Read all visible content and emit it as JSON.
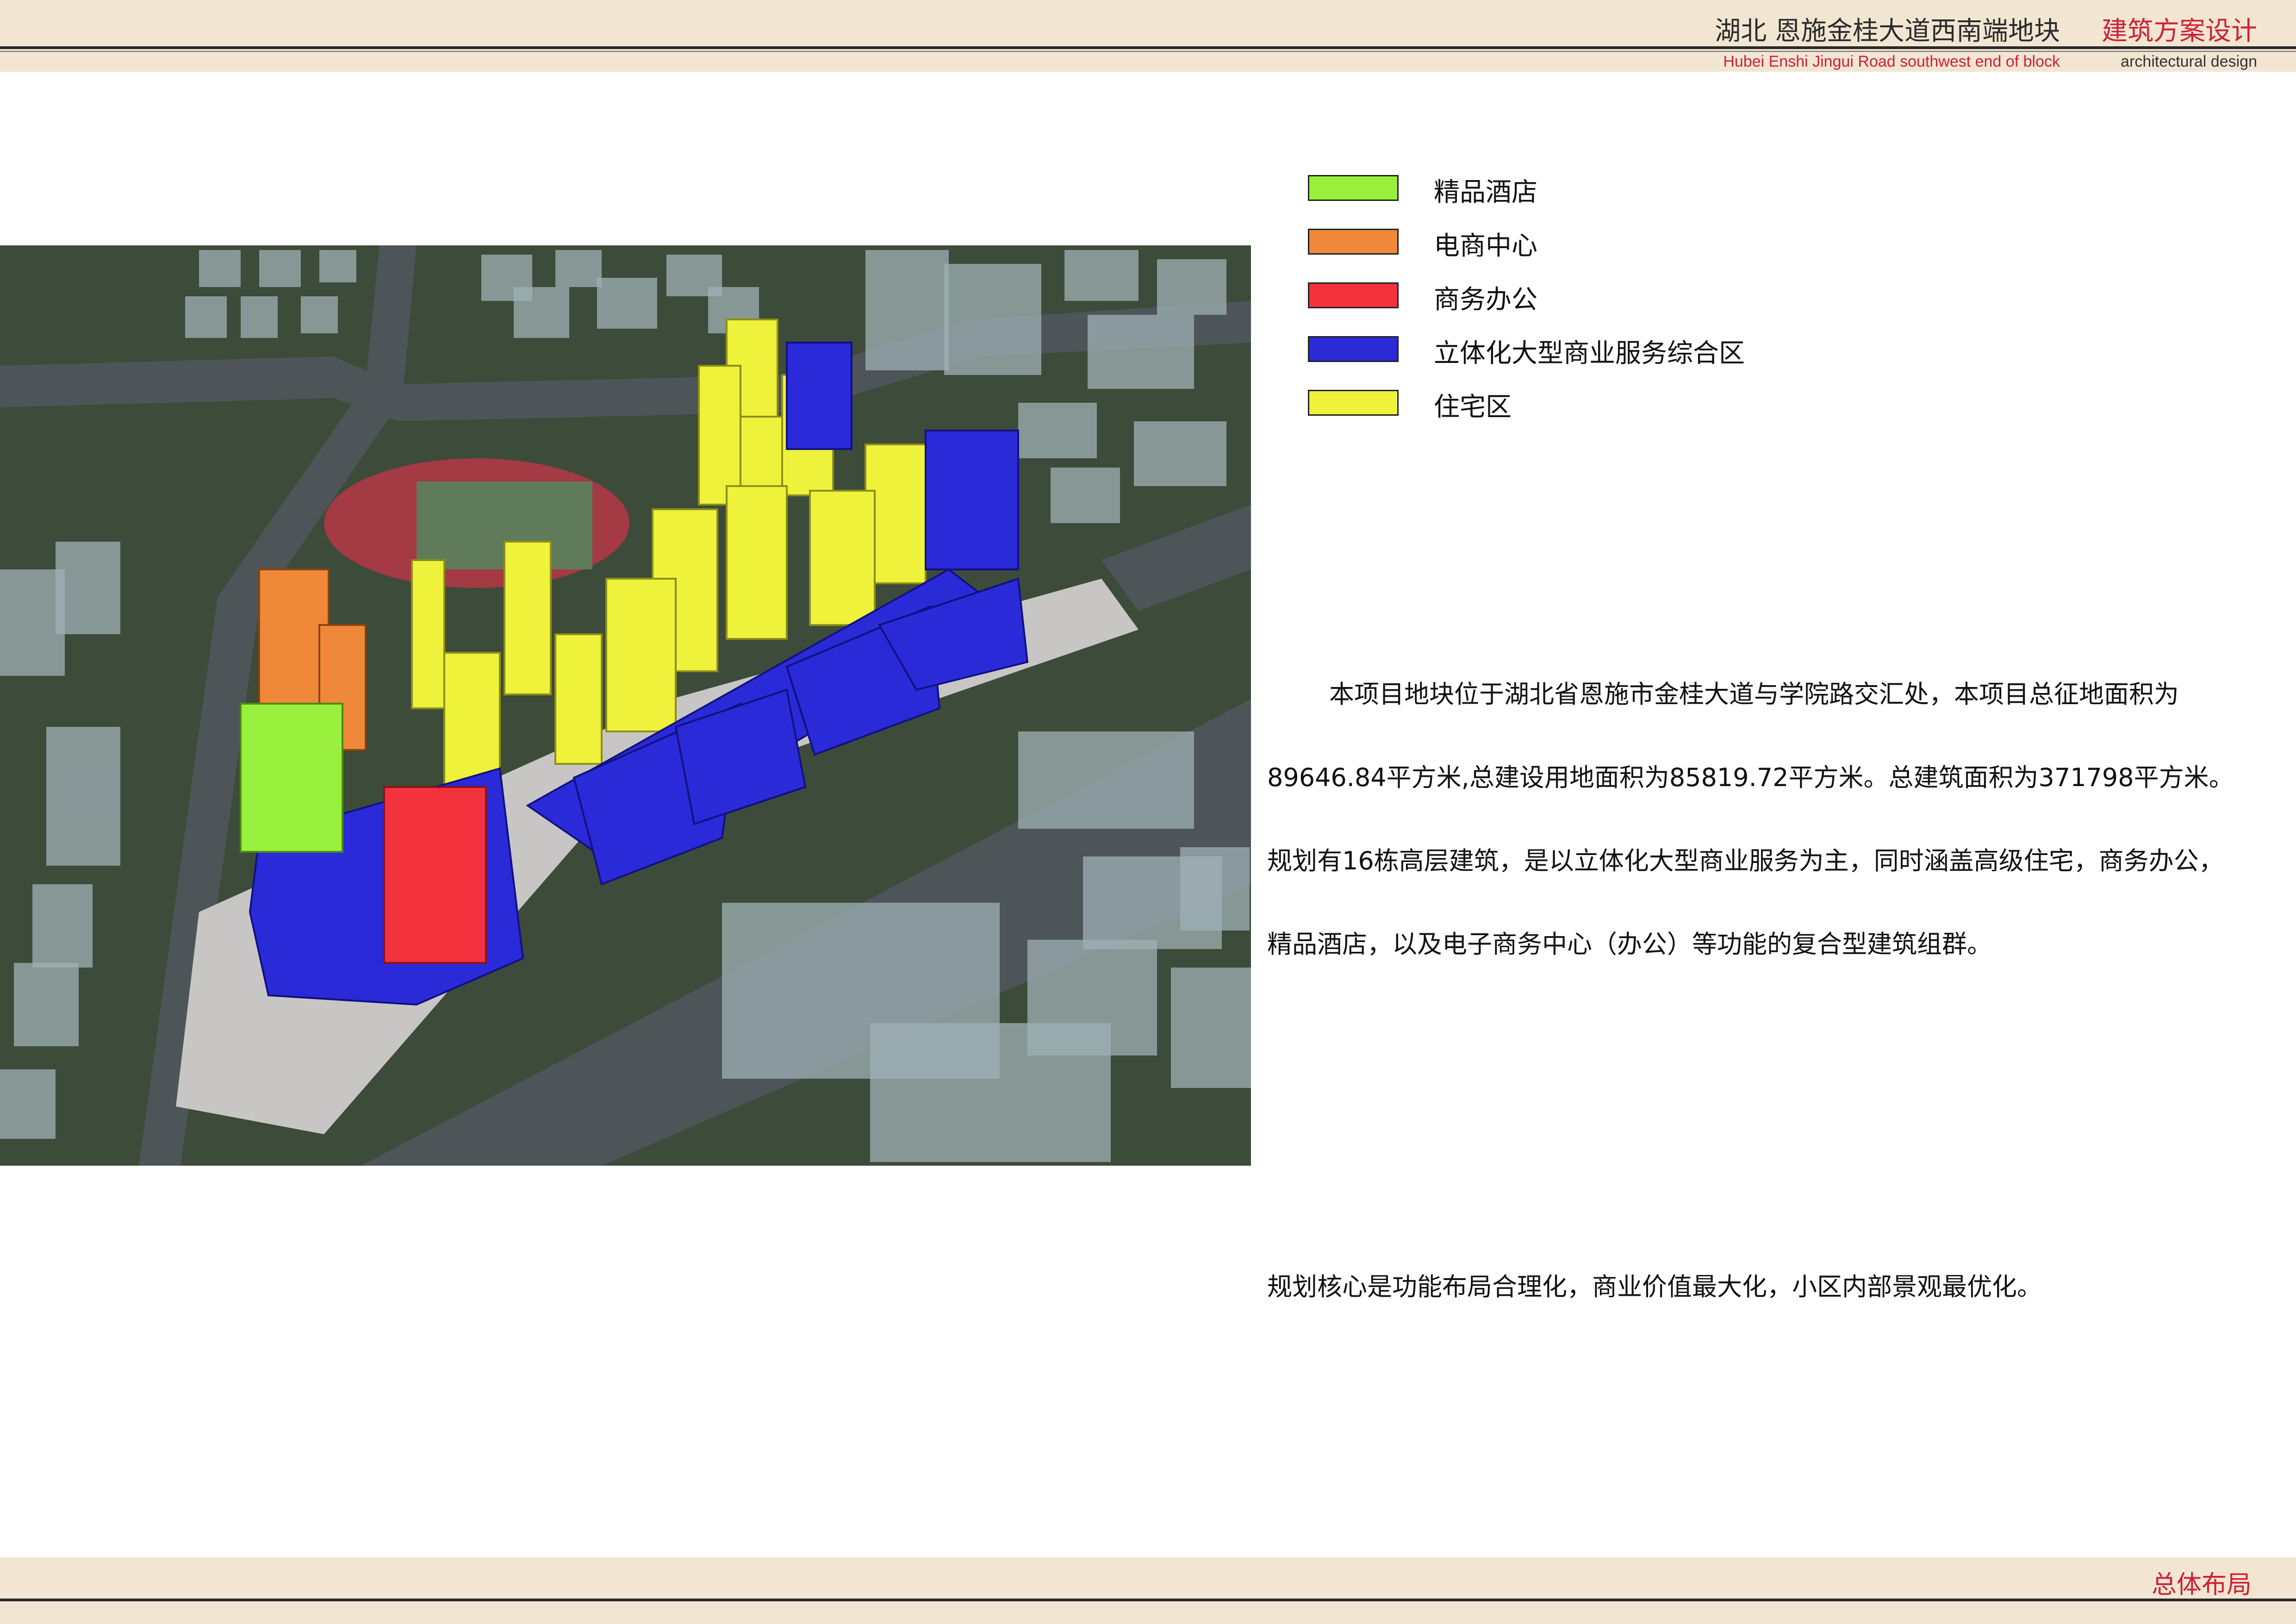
{
  "header": {
    "project_cn": "湖北 恩施金桂大道西南端地块",
    "section_cn": "建筑方案设计",
    "project_en": "Hubei Enshi Jingui Road southwest end of block",
    "section_en": "architectural design"
  },
  "legend": {
    "items": [
      {
        "label": "精品酒店",
        "color": "#99f03c"
      },
      {
        "label": "电商中心",
        "color": "#f0883a"
      },
      {
        "label": "商务办公",
        "color": "#f2323c"
      },
      {
        "label": "立体化大型商业服务综合区",
        "color": "#2a2ad8"
      },
      {
        "label": "住宅区",
        "color": "#eef23a"
      }
    ]
  },
  "description": {
    "lines": [
      "本项目地块位于湖北省恩施市金桂大道与学院路交汇处，本项目总征地面积为",
      "89646.84平方米,总建设用地面积为85819.72平方米。总建筑面积为371798平方米。",
      "规划有16栋高层建筑，是以立体化大型商业服务为主，同时涵盖高级住宅，商务办公，",
      "精品酒店，以及电子商务中心（办公）等功能的复合型建筑组群。"
    ],
    "summary": "规划核心是功能布局合理化，商业价值最大化，小区内部景观最优化。"
  },
  "footer": {
    "title": "总体布局"
  },
  "render": {
    "colors": {
      "ground": "#3d4b3a",
      "road": "#4e5558",
      "plaza": "#c8c6c4",
      "track": "#a33a44",
      "field": "#5f7b5a",
      "context": "#9fb0b6",
      "hotel": "#99f03c",
      "ecommerce": "#f0883a",
      "office": "#f2323c",
      "commercial": "#2a2ad8",
      "residential": "#eef23a"
    }
  }
}
